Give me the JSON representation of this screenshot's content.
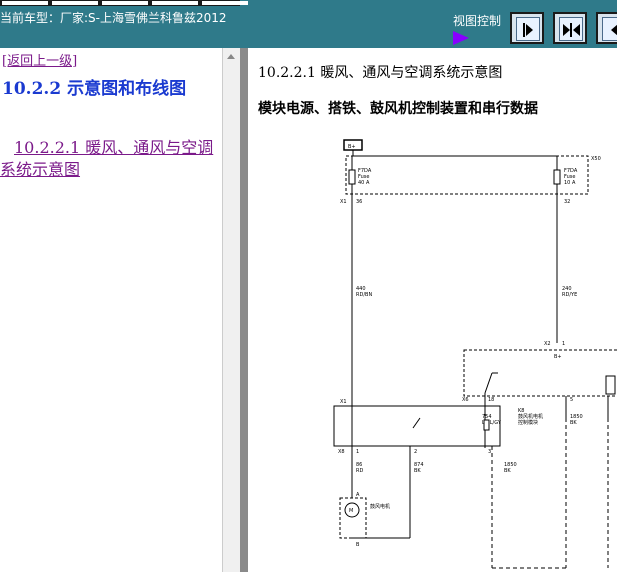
{
  "header": {
    "car_label": "当前车型：厂家:S-上海雪佛兰科鲁兹2012",
    "view_control_label": "视图控制"
  },
  "left_panel": {
    "back_link": "[返回上一级]",
    "section_title": "10.2.2 示意图和布线图",
    "sub_link": "10.2.2.1 暖风、通风与空调系统示意图"
  },
  "content": {
    "title": "10.2.2.1 暖风、通风与空调系统示意图",
    "subtitle": "模块电源、搭铁、鼓风机控制装置和串行数据"
  },
  "schematic": {
    "power_label": "B+",
    "fuse_left": [
      "F7DA",
      "Fuse",
      "40 A"
    ],
    "fuse_right": [
      "F7DA",
      "Fuse",
      "10 A"
    ],
    "box_code": "X50",
    "connector_x1": "X1",
    "pin_36": "36",
    "pin_32": "32",
    "wire_left": [
      "440",
      "RD/BN"
    ],
    "wire_right": [
      "240",
      "RD/YE"
    ],
    "conn_x2": "X2",
    "pin_1": "1",
    "pin_b": "B+",
    "pin_x6": "X6",
    "pin_18": "18",
    "pin_5": "5",
    "wire_754": [
      "754",
      "L-BL/GY"
    ],
    "wire_1850": [
      "1850",
      "BK"
    ],
    "conn_x4": "X1",
    "module_label": [
      "K8",
      "鼓风机电机",
      "控制模块"
    ],
    "pin_x8": "X8",
    "pin_2": "2",
    "pin_3": "3",
    "wire_86": [
      "86",
      "RD"
    ],
    "wire_874": [
      "874",
      "BK"
    ],
    "wire_1850b": [
      "1850",
      "BK"
    ],
    "motor_label": [
      "M",
      "鼓风电机"
    ],
    "pin_a": "A",
    "pin_bb": "B"
  },
  "colors": {
    "topbar": "#2f7a8a",
    "title_blue": "#1a3ad0",
    "link_purple": "#7b1a8a",
    "arrow_purple": "#8800ff"
  }
}
